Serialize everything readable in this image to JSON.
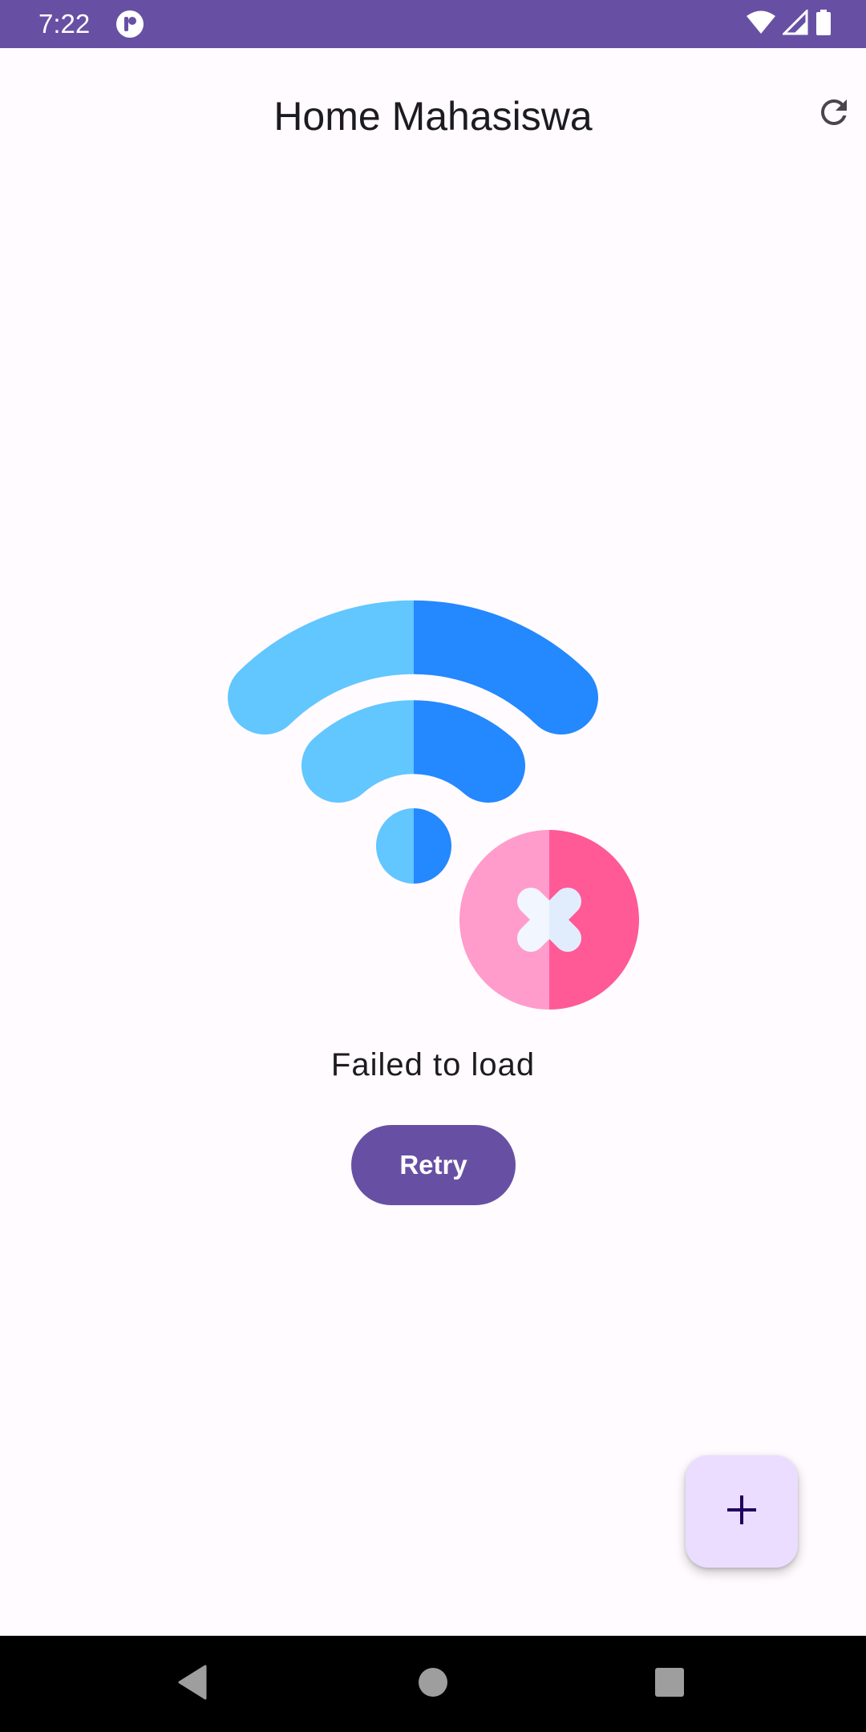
{
  "status_bar": {
    "time": "7:22",
    "icons": [
      "app-notification-icon",
      "wifi-icon",
      "signal-icon",
      "battery-icon"
    ]
  },
  "app_bar": {
    "title": "Home Mahasiswa",
    "action_icon": "refresh-icon"
  },
  "error_state": {
    "illustration": "wifi-off-illustration",
    "message": "Failed to load",
    "retry_label": "Retry"
  },
  "fab": {
    "icon": "plus-icon"
  },
  "nav_bar": {
    "buttons": [
      "back-icon",
      "home-icon",
      "recents-icon"
    ]
  },
  "colors": {
    "primary": "#6750A4",
    "background": "#FFFBFE",
    "fab_container": "#EADDFF",
    "on_fab": "#21005D",
    "wifi_light": "#62C6FF",
    "wifi_dark": "#2488FF",
    "error_light": "#FF9CCB",
    "error_dark": "#FF5A95"
  }
}
